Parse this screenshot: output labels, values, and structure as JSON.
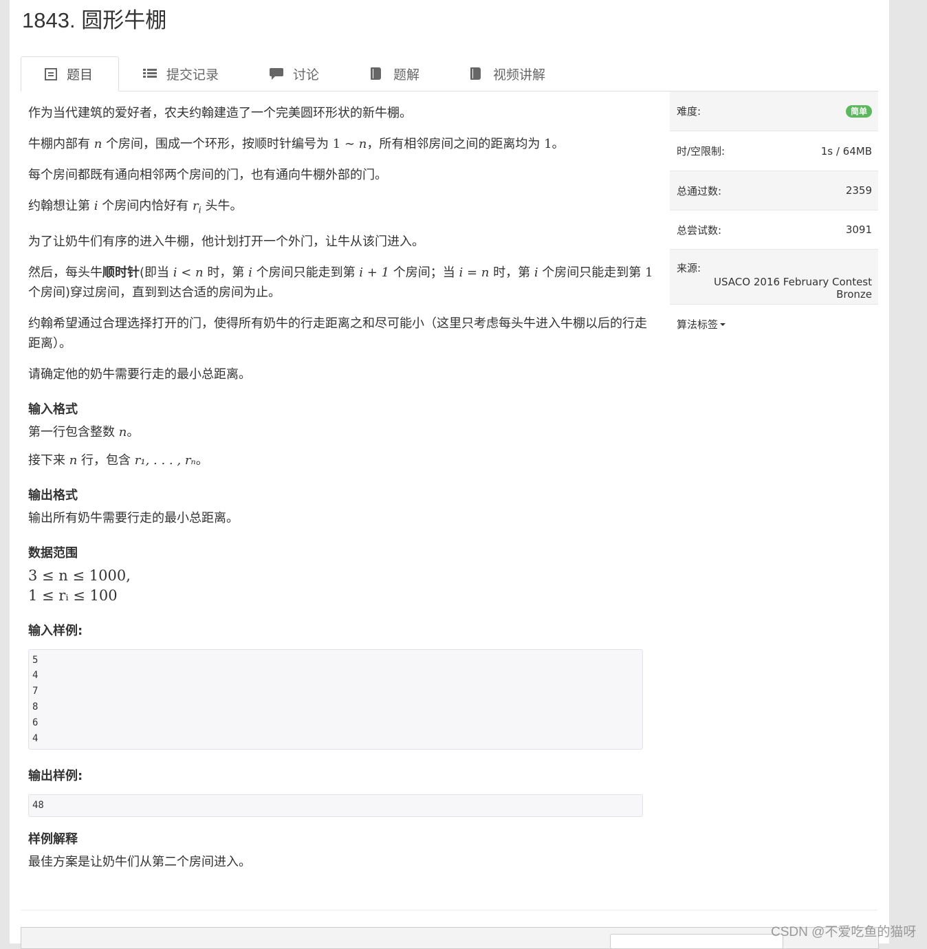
{
  "problem": {
    "title": "1843. 圆形牛棚"
  },
  "tabs": [
    {
      "label": "题目",
      "icon": "list-alt-icon"
    },
    {
      "label": "提交记录",
      "icon": "list-icon"
    },
    {
      "label": "讨论",
      "icon": "comment-icon"
    },
    {
      "label": "题解",
      "icon": "book-icon"
    },
    {
      "label": "视频讲解",
      "icon": "book-icon"
    }
  ],
  "desc": {
    "p1": "作为当代建筑的爱好者，农夫约翰建造了一个完美圆环形状的新牛棚。",
    "p2a": "牛棚内部有 ",
    "p2n": "n",
    "p2b": " 个房间，围成一个环形，按顺时针编号为 ",
    "p2c": "1 ∼ ",
    "p2d": "n",
    "p2e": "，所有相邻房间之间的距离均为 ",
    "p2f": "1",
    "p2g": "。",
    "p3": "每个房间都既有通向相邻两个房间的门，也有通向牛棚外部的门。",
    "p4a": "约翰想让第 ",
    "p4i": "i",
    "p4b": " 个房间内恰好有 ",
    "p4r": "r",
    "p4ri": "i",
    "p4c": " 头牛。",
    "p5": "为了让奶牛们有序的进入牛棚，他计划打开一个外门，让牛从该门进入。",
    "p6a": "然后，每头牛",
    "p6bold": "顺时针",
    "p6b": "(即当 ",
    "p6m1": "i < n",
    "p6c": " 时，第 ",
    "p6m2": "i",
    "p6d": " 个房间只能走到第 ",
    "p6m3": "i + 1",
    "p6e": " 个房间；当 ",
    "p6m4": "i = n",
    "p6f": " 时，第 ",
    "p6m5": "i",
    "p6g": " 个房间只能走到第 ",
    "p6m6": "1",
    "p6h": " 个房间)穿过房间，直到到达合适的房间为止。",
    "p7": "约翰希望通过合理选择打开的门，使得所有奶牛的行走距离之和尽可能小（这里只考虑每头牛进入牛棚以后的行走距离）。",
    "p8": "请确定他的奶牛需要行走的最小总距离。"
  },
  "input_format": {
    "heading": "输入格式",
    "l1a": "第一行包含整数 ",
    "l1n": "n",
    "l1b": "。",
    "l2a": "接下来 ",
    "l2n": "n",
    "l2b": " 行，包含 ",
    "l2m": "r₁, . . . , rₙ",
    "l2c": "。"
  },
  "output_format": {
    "heading": "输出格式",
    "text": "输出所有奶牛需要行走的最小总距离。"
  },
  "data_range": {
    "heading": "数据范围",
    "line1": "3 ≤ n ≤ 1000,",
    "line2": "1 ≤ rᵢ ≤ 100"
  },
  "sample_input": {
    "heading": "输入样例:",
    "text": "5\n4\n7\n8\n6\n4"
  },
  "sample_output": {
    "heading": "输出样例:",
    "text": "48"
  },
  "explanation": {
    "heading": "样例解释",
    "text": "最佳方案是让奶牛们从第二个房间进入。"
  },
  "sidebar": {
    "difficulty_label": "难度:",
    "difficulty_value": "简单",
    "difficulty_color": "#5cb85c",
    "limit_label": "时/空限制:",
    "limit_value": "1s / 64MB",
    "passed_label": "总通过数:",
    "passed_value": "2359",
    "tried_label": "总尝试数:",
    "tried_value": "3091",
    "source_label": "来源:",
    "source_value": "USACO 2016 February Contest Bronze",
    "tags_label": "算法标签"
  },
  "watermark": "CSDN @不爱吃鱼的猫呀"
}
